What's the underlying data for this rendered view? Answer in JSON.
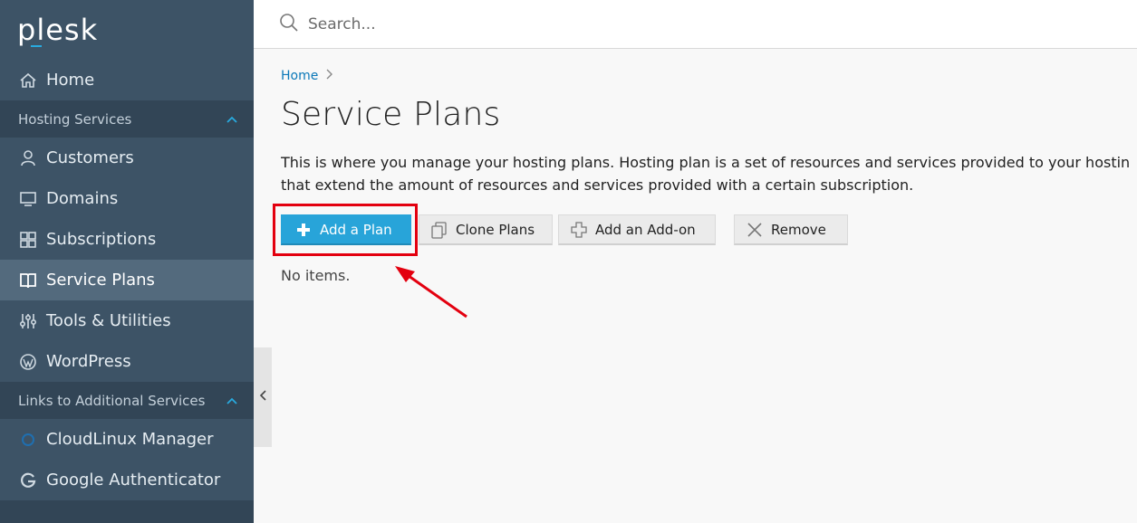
{
  "brand": {
    "logo_text": "plesk"
  },
  "search": {
    "placeholder": "Search..."
  },
  "sidebar": {
    "home": "Home",
    "sections": [
      {
        "title": "Hosting Services",
        "items": [
          "Customers",
          "Domains",
          "Subscriptions",
          "Service Plans",
          "Tools & Utilities",
          "WordPress"
        ]
      },
      {
        "title": "Links to Additional Services",
        "items": [
          "CloudLinux Manager",
          "Google Authenticator"
        ]
      }
    ],
    "active_item": "Service Plans"
  },
  "breadcrumb": {
    "home": "Home"
  },
  "page": {
    "title": "Service Plans",
    "description_line1": "This is where you manage your hosting plans. Hosting plan is a set of resources and services provided to your hostin",
    "description_line2": "that extend the amount of resources and services provided with a certain subscription.",
    "empty_text": "No items."
  },
  "toolbar": {
    "add_plan": "Add a Plan",
    "clone_plans": "Clone Plans",
    "add_addon": "Add an Add-on",
    "remove": "Remove"
  },
  "colors": {
    "sidebar_bg": "#3d5366",
    "accent": "#28a4d9",
    "highlight": "#e3000f"
  }
}
